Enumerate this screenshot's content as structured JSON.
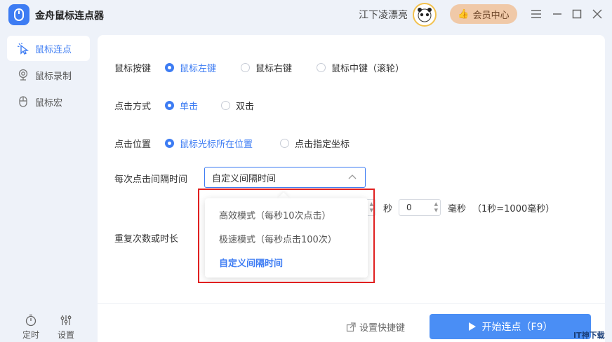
{
  "app": {
    "title": "金舟鼠标连点器",
    "username": "江下凌漂亮",
    "vip_label": "会员中心"
  },
  "sidebar": {
    "items": [
      {
        "label": "鼠标连点",
        "icon": "cursor-click-icon",
        "active": true
      },
      {
        "label": "鼠标录制",
        "icon": "record-icon",
        "active": false
      },
      {
        "label": "鼠标宏",
        "icon": "mouse-icon",
        "active": false
      }
    ],
    "bottom": [
      {
        "label": "定时",
        "icon": "timer-icon"
      },
      {
        "label": "设置",
        "icon": "sliders-icon"
      }
    ]
  },
  "settings": {
    "button": {
      "label": "鼠标按键",
      "options": [
        "鼠标左键",
        "鼠标右键",
        "鼠标中键（滚轮）"
      ],
      "selected": 0
    },
    "click_mode": {
      "label": "点击方式",
      "options": [
        "单击",
        "双击"
      ],
      "selected": 0
    },
    "position": {
      "label": "点击位置",
      "options": [
        "鼠标光标所在位置",
        "点击指定坐标"
      ],
      "selected": 0
    },
    "interval": {
      "label": "每次点击间隔时间",
      "selected_value": "自定义间隔时间",
      "dropdown_options": [
        "高效模式（每秒10次点击）",
        "极速模式（每秒点击100次）",
        "自定义间隔时间"
      ],
      "dropdown_selected": 2,
      "seconds_unit": "秒",
      "ms_value": "0",
      "ms_unit": "毫秒",
      "hint": "（1秒=1000毫秒）"
    },
    "repeat": {
      "label": "重复次数或时长"
    }
  },
  "footer": {
    "shortcut_label": "设置快捷键",
    "start_label": "开始连点（F9）"
  },
  "watermark": "IT神下载网",
  "colors": {
    "accent": "#3d7cf3",
    "highlight": "#e02020",
    "start_button": "#4a8ef5"
  }
}
